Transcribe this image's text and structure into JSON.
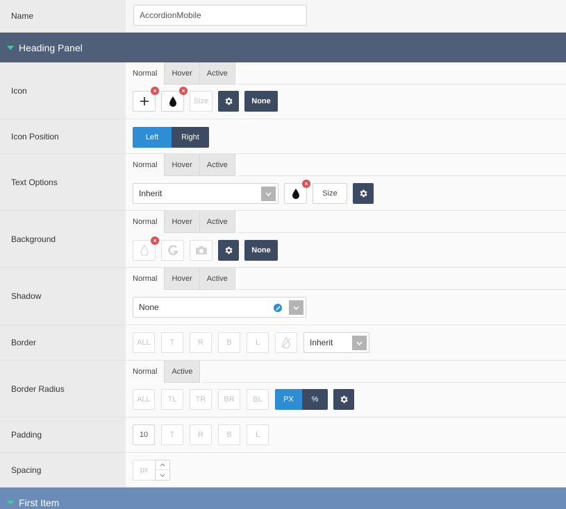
{
  "name_row": {
    "label": "Name",
    "value": "AccordionMobile"
  },
  "heading_panel": {
    "title": "Heading Panel"
  },
  "tabs3": [
    "Normal",
    "Hover",
    "Active"
  ],
  "tabs2": [
    "Normal",
    "Active"
  ],
  "icon_row": {
    "label": "Icon",
    "size_placeholder": "Size",
    "none_label": "None"
  },
  "icon_position_row": {
    "label": "Icon Position",
    "left": "Left",
    "right": "Right"
  },
  "text_options_row": {
    "label": "Text Options",
    "font": "Inherit",
    "size_placeholder": "Size"
  },
  "background_row": {
    "label": "Background",
    "none_label": "None"
  },
  "shadow_row": {
    "label": "Shadow",
    "value": "None"
  },
  "border_row": {
    "label": "Border",
    "sides": [
      "ALL",
      "T",
      "R",
      "B",
      "L"
    ],
    "style": "Inherit"
  },
  "border_radius_row": {
    "label": "Border Radius",
    "corners": [
      "ALL",
      "TL",
      "TR",
      "BR",
      "BL"
    ],
    "unit_px": "PX",
    "unit_pct": "%"
  },
  "padding_row": {
    "label": "Padding",
    "sides": [
      "10",
      "T",
      "R",
      "B",
      "L"
    ]
  },
  "spacing_row": {
    "label": "Spacing",
    "placeholder": "px"
  },
  "first_item": {
    "title": "First Item"
  },
  "colors": {
    "header_dark": "#4f5f79",
    "header_light": "#6b8cb8",
    "accent_blue": "#2d8ed6",
    "dark_button": "#3c4a62"
  }
}
